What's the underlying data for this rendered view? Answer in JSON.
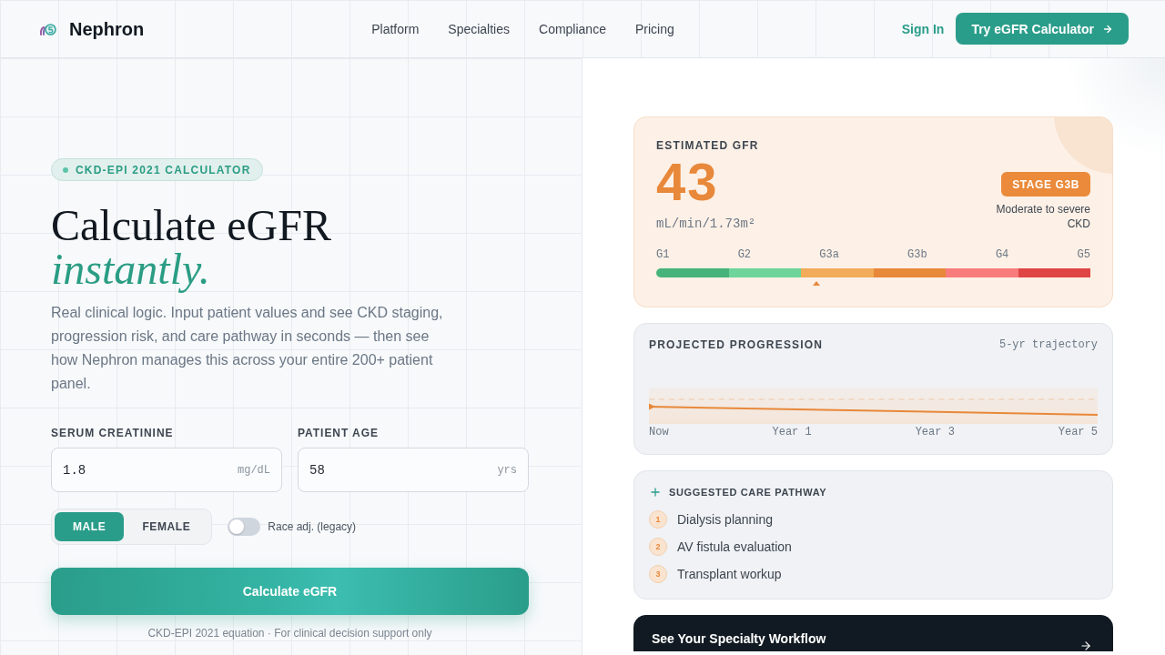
{
  "header": {
    "brand": "Nephron",
    "nav": [
      "Platform",
      "Specialties",
      "Compliance",
      "Pricing"
    ],
    "sign_in": "Sign In",
    "cta": "Try eGFR Calculator"
  },
  "hero": {
    "badge": "CKD-EPI 2021 CALCULATOR",
    "title": "Calculate eGFR",
    "title_accent": "instantly.",
    "description": "Real clinical logic. Input patient values and see CKD staging, progression risk, and care pathway in seconds — then see how Nephron manages this across your entire 200+ patient panel."
  },
  "form": {
    "fields": [
      {
        "label": "SERUM CREATININE",
        "value": "1.8",
        "unit": "mg/dL"
      },
      {
        "label": "PATIENT AGE",
        "value": "58",
        "unit": "yrs"
      }
    ],
    "sex_options": [
      {
        "label": "MALE",
        "selected": true
      },
      {
        "label": "FEMALE",
        "selected": false
      }
    ],
    "race_adjustment": {
      "label": "Race adj. (legacy)",
      "on": false
    },
    "submit": "Calculate eGFR",
    "footnote": "CKD-EPI 2021 equation · For clinical decision support only"
  },
  "result": {
    "title": "ESTIMATED GFR",
    "value": "43",
    "unit": "mL/min/1.73m²",
    "stage_badge": "STAGE G3B",
    "stage_description": "Moderate to severe CKD",
    "stages": [
      {
        "label": "G1",
        "color": "#46b37a"
      },
      {
        "label": "G2",
        "color": "#6dd59a"
      },
      {
        "label": "G3a",
        "color": "#f2ab58"
      },
      {
        "label": "G3b",
        "color": "#e8883a"
      },
      {
        "label": "G4",
        "color": "#f87c7c"
      },
      {
        "label": "G5",
        "color": "#e04545"
      }
    ],
    "marker": {
      "level": 0.37
    }
  },
  "progression": {
    "title": "PROJECTED PROGRESSION",
    "subtitle": "5-yr trajectory",
    "x_labels": [
      "Now",
      "Year 1",
      "Year 3",
      "Year 5"
    ]
  },
  "care_pathway": {
    "title": "SUGGESTED CARE PATHWAY",
    "steps": [
      {
        "number": "1",
        "label": "Dialysis planning"
      },
      {
        "number": "2",
        "label": "AV fistula evaluation"
      },
      {
        "number": "3",
        "label": "Transplant workup"
      }
    ]
  },
  "workflow_cta": {
    "title": "See Your Specialty Workflow"
  }
}
